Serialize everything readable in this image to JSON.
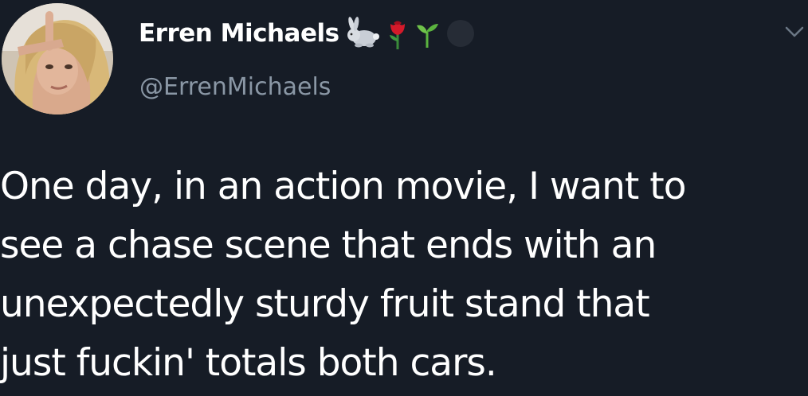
{
  "tweet": {
    "author": {
      "display_name": "Erren Michaels",
      "handle": "@ErrenMichaels"
    },
    "name_emojis": [
      "rabbit-icon",
      "rose-icon",
      "seedling-icon",
      "dark-circle-icon"
    ],
    "text": "One day, in an action movie, I want to\nsee a chase scene that ends with an\nunexpectedly sturdy fruit stand that\njust fuckin' totals both cars.",
    "menu_icon": "chevron-down-icon"
  },
  "colors": {
    "background": "#161c26",
    "text": "#ffffff",
    "handle": "#8a97a5",
    "chevron": "#6b7785"
  }
}
